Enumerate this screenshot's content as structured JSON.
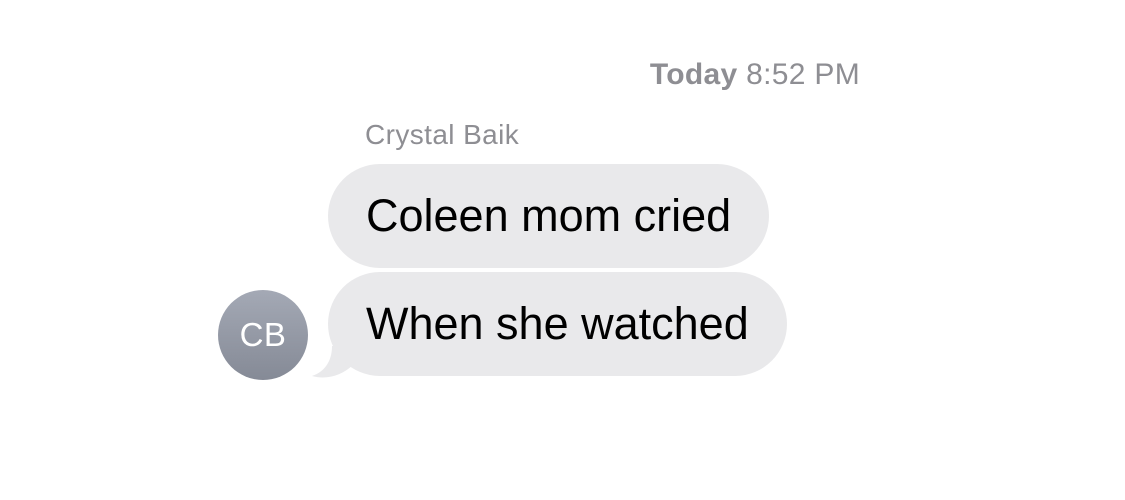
{
  "thread": {
    "timestamp_day": "Today",
    "timestamp_time": "8:52 PM",
    "sender_name": "Crystal Baik",
    "avatar_initials": "CB",
    "messages": [
      {
        "text": "Coleen mom cried"
      },
      {
        "text": "When she watched"
      }
    ]
  },
  "colors": {
    "bubble_incoming": "#e9e9eb",
    "meta_text": "#8e8e93",
    "avatar_bg": "#8e939f"
  }
}
